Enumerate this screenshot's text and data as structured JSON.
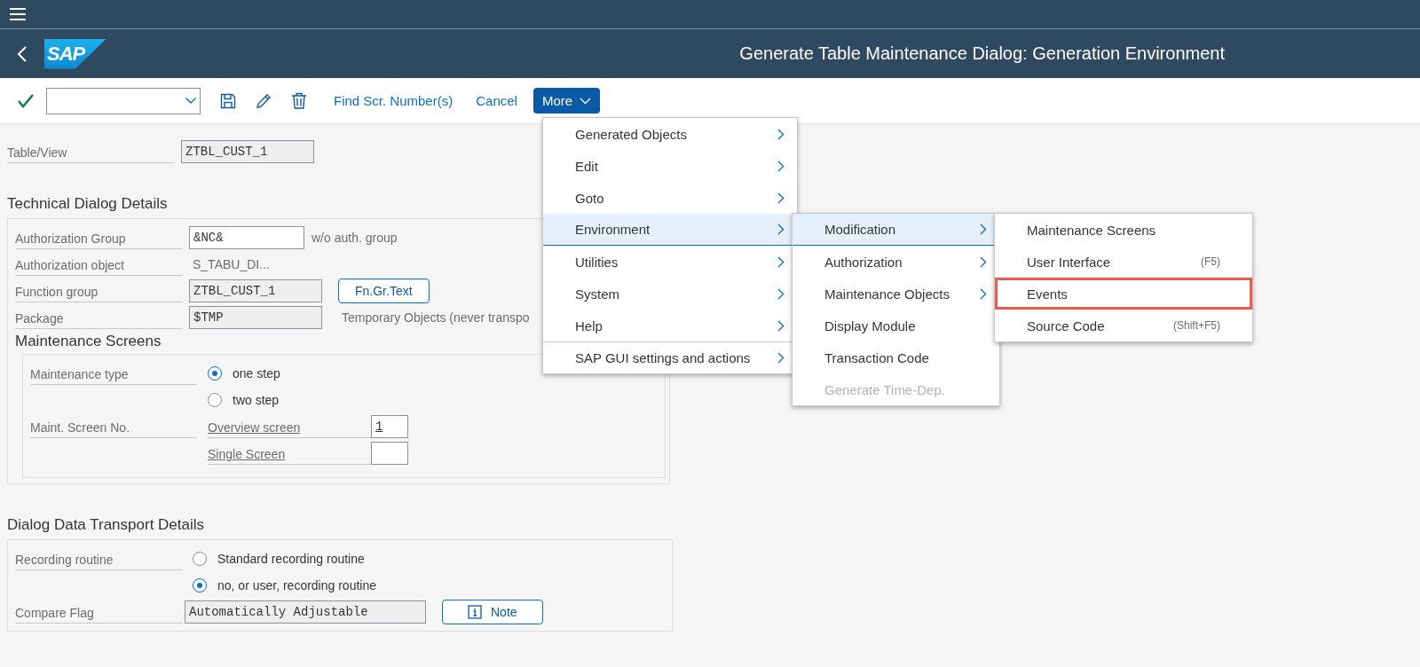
{
  "shell": {
    "logo": "SAP",
    "title": "Generate Table Maintenance Dialog: Generation Environment"
  },
  "toolbar": {
    "actions": [
      "Find Scr. Number(s)",
      "Cancel"
    ],
    "more": "More"
  },
  "table_view": {
    "label": "Table/View",
    "value": "ZTBL_CUST_1"
  },
  "technical": {
    "title": "Technical Dialog Details",
    "rows": [
      {
        "kind": "input",
        "label": "Authorization Group",
        "value": "&NC&",
        "note": "w/o auth. group"
      },
      {
        "kind": "text",
        "label": "Authorization object",
        "value": "S_TABU_DI..."
      },
      {
        "kind": "readonly",
        "label": "Function group",
        "value": "ZTBL_CUST_1",
        "button": "Fn.Gr.Text"
      },
      {
        "kind": "readonly",
        "label": "Package",
        "value": "$TMP",
        "note": "Temporary Objects (never transpo"
      }
    ]
  },
  "maintenance": {
    "title": "Maintenance Screens",
    "type_label": "Maintenance type",
    "options": [
      {
        "label": "one step",
        "selected": true
      },
      {
        "label": "two step",
        "selected": false
      }
    ],
    "screen_label": "Maint. Screen No.",
    "screens": [
      {
        "label": "Overview screen",
        "value": "1"
      },
      {
        "label": "Single Screen"
      }
    ]
  },
  "transport": {
    "title": "Dialog Data Transport Details",
    "recording_label": "Recording routine",
    "options": [
      {
        "label": "Standard recording routine",
        "selected": false
      },
      {
        "label": "no, or user, recording routine",
        "selected": true
      }
    ],
    "compare_label": "Compare Flag",
    "compare_value": "Automatically Adjustable",
    "note_button": "Note"
  },
  "menu": {
    "items": [
      {
        "label": "Generated Objects",
        "selected": false,
        "separator_before": false
      },
      {
        "label": "Edit",
        "selected": false,
        "separator_before": false
      },
      {
        "label": "Goto",
        "selected": false,
        "separator_before": false
      },
      {
        "label": "Environment",
        "selected": true,
        "separator_before": false
      },
      {
        "label": "Utilities",
        "selected": false,
        "separator_before": false
      },
      {
        "label": "System",
        "selected": false,
        "separator_before": false
      },
      {
        "label": "Help",
        "selected": false,
        "separator_before": false
      },
      {
        "label": "SAP GUI settings and actions",
        "selected": false,
        "separator_before": true
      }
    ]
  },
  "environment_menu": {
    "items": [
      {
        "label": "Modification",
        "selected": true,
        "submenu": true,
        "disabled": false
      },
      {
        "label": "Authorization",
        "selected": false,
        "submenu": true,
        "disabled": false
      },
      {
        "label": "Maintenance Objects",
        "selected": false,
        "submenu": true,
        "disabled": false
      },
      {
        "label": "Display Module",
        "selected": false,
        "submenu": false,
        "disabled": false
      },
      {
        "label": "Transaction Code",
        "selected": false,
        "submenu": false,
        "disabled": false
      },
      {
        "label": "Generate Time-Dep.",
        "selected": false,
        "submenu": false,
        "disabled": true
      }
    ]
  },
  "modification_menu": {
    "items": [
      {
        "label": "Maintenance Screens",
        "highlighted": false
      },
      {
        "label": "User Interface",
        "shortcut": "(F5)",
        "highlighted": false
      },
      {
        "label": "Events",
        "highlighted": true
      },
      {
        "label": "Source Code",
        "shortcut": "(Shift+F5)",
        "highlighted": false
      }
    ]
  }
}
